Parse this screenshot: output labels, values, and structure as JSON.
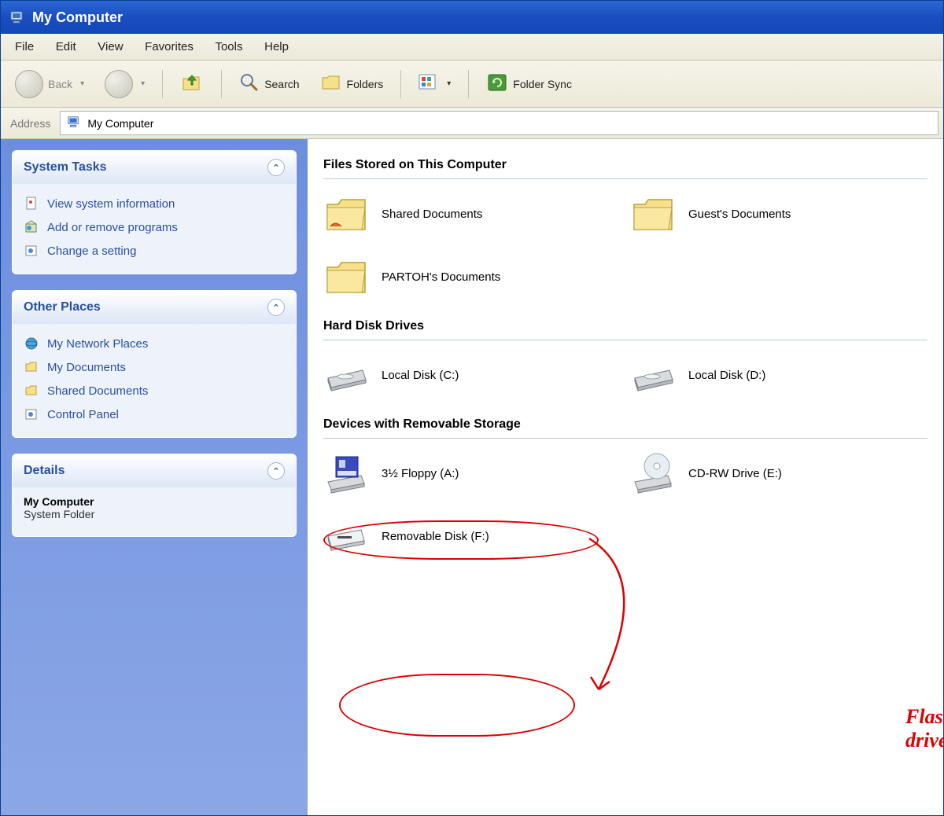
{
  "titlebar": {
    "title": "My Computer"
  },
  "menu": {
    "items": [
      "File",
      "Edit",
      "View",
      "Favorites",
      "Tools",
      "Help"
    ]
  },
  "toolbar": {
    "back": "Back",
    "search": "Search",
    "folders": "Folders",
    "folder_sync": "Folder Sync"
  },
  "address": {
    "label": "Address",
    "value": "My Computer"
  },
  "panels": {
    "system_tasks": {
      "title": "System Tasks",
      "links": [
        "View system information",
        "Add or remove programs",
        "Change a setting"
      ]
    },
    "other_places": {
      "title": "Other Places",
      "links": [
        "My Network Places",
        "My Documents",
        "Shared Documents",
        "Control Panel"
      ]
    },
    "details": {
      "title": "Details",
      "item_title": "My Computer",
      "item_sub": "System Folder"
    }
  },
  "sections": {
    "files": {
      "title": "Files Stored on This Computer",
      "items": [
        "Shared Documents",
        "Guest's Documents",
        "PARTOH's Documents"
      ]
    },
    "hdd": {
      "title": "Hard Disk Drives",
      "items": [
        "Local Disk (C:)",
        "Local Disk (D:)"
      ]
    },
    "removable": {
      "title": "Devices with Removable Storage",
      "items": [
        "3½ Floppy (A:)",
        "CD-RW Drive (E:)",
        "Removable Disk (F:)"
      ]
    }
  },
  "annotation": {
    "label": "Flash drive"
  }
}
